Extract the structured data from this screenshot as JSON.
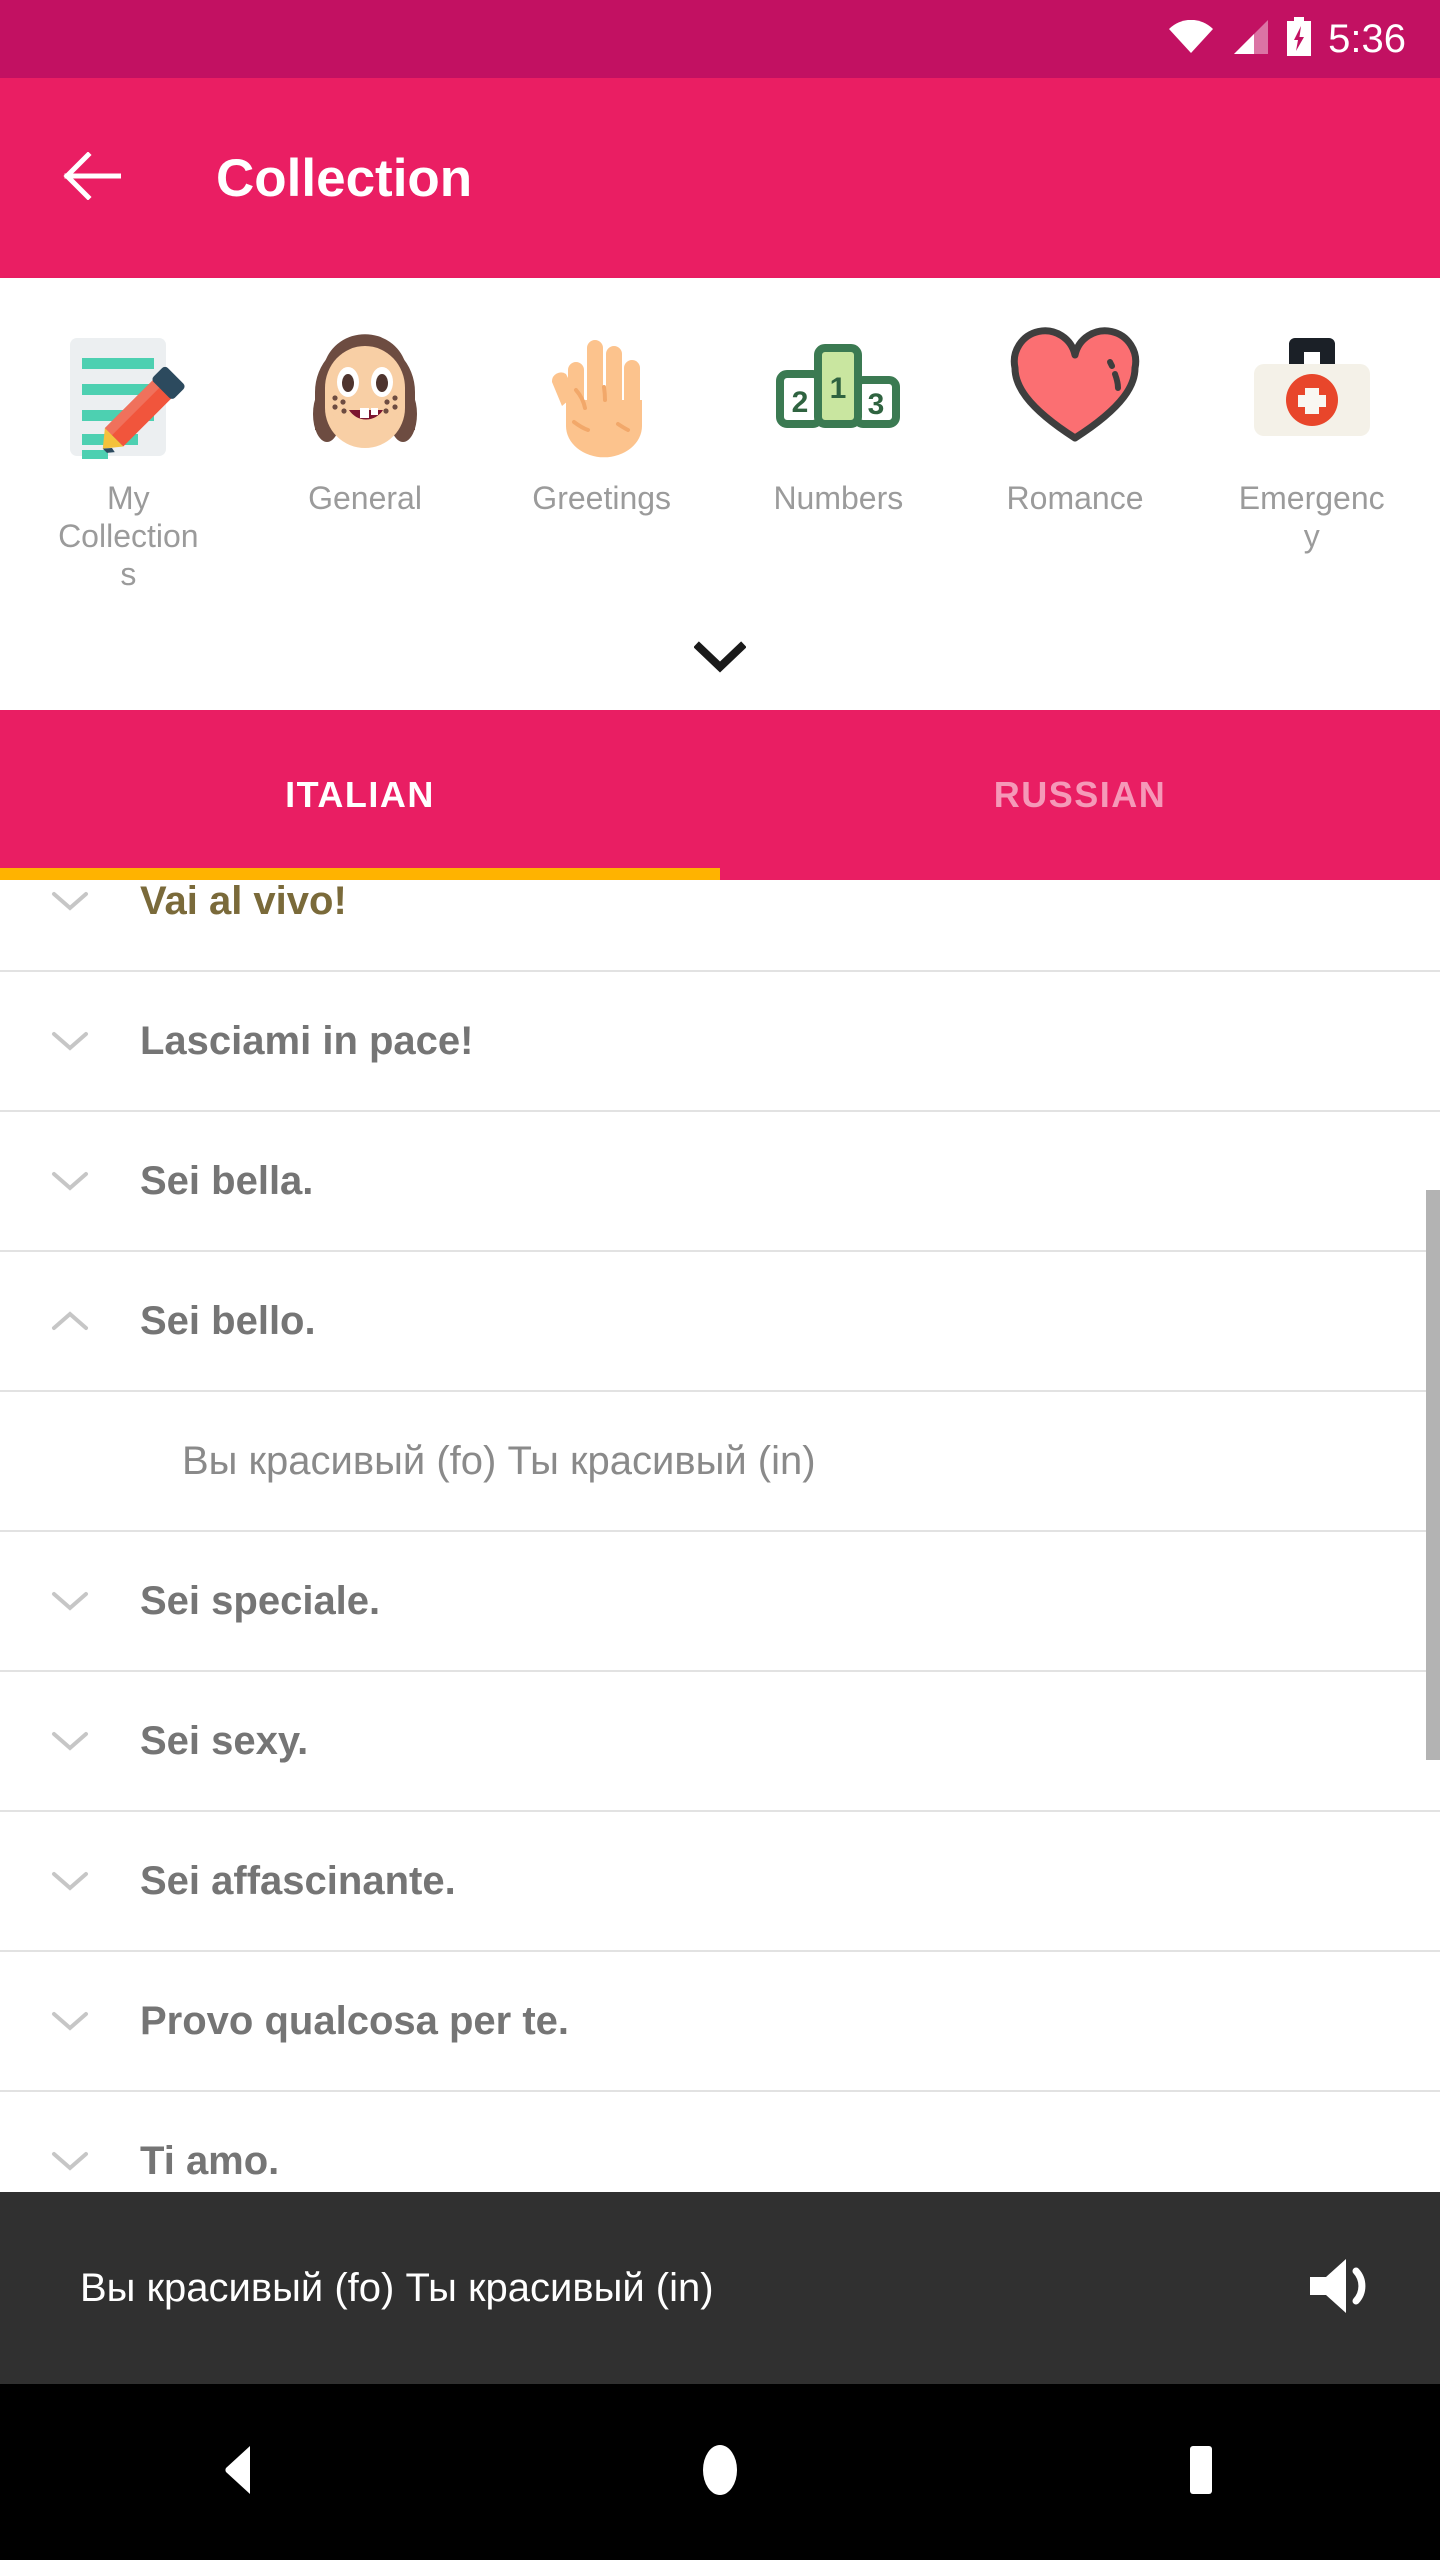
{
  "status_bar": {
    "time": "5:36",
    "wifi_icon": "wifi-icon",
    "signal_icon": "cellular-signal-icon",
    "battery_icon": "battery-charging-icon",
    "background_color": "#C21162"
  },
  "app_bar": {
    "title": "Collection",
    "back_icon": "back-arrow-icon",
    "background_color": "#E91E63"
  },
  "categories": {
    "expander_icon": "chevron-down-icon",
    "items": [
      {
        "label": "My Collections",
        "icon": "memo-pencil-icon"
      },
      {
        "label": "General",
        "icon": "girl-face-icon"
      },
      {
        "label": "Greetings",
        "icon": "raised-hand-icon"
      },
      {
        "label": "Numbers",
        "icon": "podium-123-icon"
      },
      {
        "label": "Romance",
        "icon": "heart-icon"
      },
      {
        "label": "Emergency",
        "icon": "first-aid-kit-icon"
      }
    ]
  },
  "tabs": {
    "active_index": 0,
    "indicator_color": "#FFB300",
    "items": [
      {
        "label": "ITALIAN",
        "active": true
      },
      {
        "label": "RUSSIAN",
        "active": false
      }
    ]
  },
  "phrase_list": {
    "clipped_top_row": {
      "text": "Vai al vivo!",
      "chevron": "chevron-down-icon"
    },
    "rows": [
      {
        "text": "Lasciami in pace!",
        "expanded": false,
        "chevron": "chevron-down-icon"
      },
      {
        "text": "Sei bella.",
        "expanded": false,
        "chevron": "chevron-down-icon"
      },
      {
        "text": "Sei bello.",
        "expanded": true,
        "chevron": "chevron-up-icon"
      },
      {
        "text": "Вы красивый (fo)  Ты красивый (in)",
        "translation": true
      },
      {
        "text": "Sei speciale.",
        "expanded": false,
        "chevron": "chevron-down-icon"
      },
      {
        "text": "Sei sexy.",
        "expanded": false,
        "chevron": "chevron-down-icon"
      },
      {
        "text": "Sei affascinante.",
        "expanded": false,
        "chevron": "chevron-down-icon"
      },
      {
        "text": "Provo qualcosa per te.",
        "expanded": false,
        "chevron": "chevron-down-icon"
      },
      {
        "text": "Ti amo.",
        "expanded": false,
        "chevron": "chevron-down-icon"
      }
    ]
  },
  "player_bar": {
    "text": "Вы красивый (fo)  Ты красивый (in)",
    "speaker_icon": "speaker-volume-icon",
    "background_color": "#303030"
  },
  "nav_bar": {
    "back_icon": "nav-back-triangle-icon",
    "home_icon": "nav-home-circle-icon",
    "recents_icon": "nav-recents-square-icon"
  }
}
